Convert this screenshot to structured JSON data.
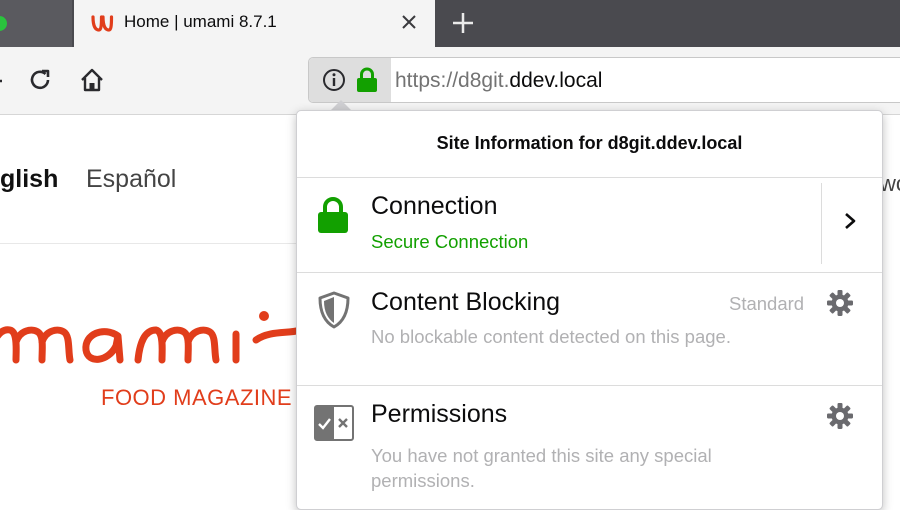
{
  "browser": {
    "tab": {
      "title": "Home | umami 8.7.1",
      "close_icon": "close-icon"
    },
    "new_tab_icon": "plus-icon",
    "url": {
      "prefix": "https://d8git.",
      "host": "ddev.local"
    }
  },
  "page": {
    "languages": [
      "glish",
      "Español"
    ],
    "logo_text": "umami",
    "tagline": "FOOD MAGAZINE",
    "right_peek": "wo"
  },
  "popup": {
    "title": "Site Information for d8git.ddev.local",
    "connection": {
      "title": "Connection",
      "status": "Secure Connection",
      "status_color": "#12a000"
    },
    "content_blocking": {
      "title": "Content Blocking",
      "level": "Standard",
      "description": "No blockable content detected on this page."
    },
    "permissions": {
      "title": "Permissions",
      "description_line1": "You have not granted this site any special",
      "description_line2": "permissions."
    }
  },
  "colors": {
    "brand": "#e13d1b",
    "secure": "#12a000",
    "toolbar": "#4a4a4f"
  }
}
